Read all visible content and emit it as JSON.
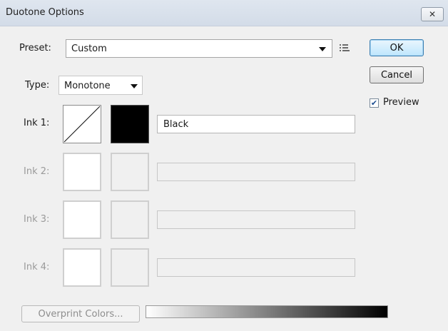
{
  "dialog": {
    "title": "Duotone Options"
  },
  "preset": {
    "label": "Preset:",
    "value": "Custom"
  },
  "buttons": {
    "ok": "OK",
    "cancel": "Cancel",
    "overprint": "Overprint Colors..."
  },
  "preview": {
    "label": "Preview",
    "checked": true
  },
  "type": {
    "label": "Type:",
    "value": "Monotone"
  },
  "inks": [
    {
      "label": "Ink 1:",
      "name": "Black",
      "enabled": true,
      "color": "#000000"
    },
    {
      "label": "Ink 2:",
      "name": "",
      "enabled": false
    },
    {
      "label": "Ink 3:",
      "name": "",
      "enabled": false
    },
    {
      "label": "Ink 4:",
      "name": "",
      "enabled": false
    }
  ],
  "ramp": {
    "from": "#ffffff",
    "to": "#000000"
  }
}
